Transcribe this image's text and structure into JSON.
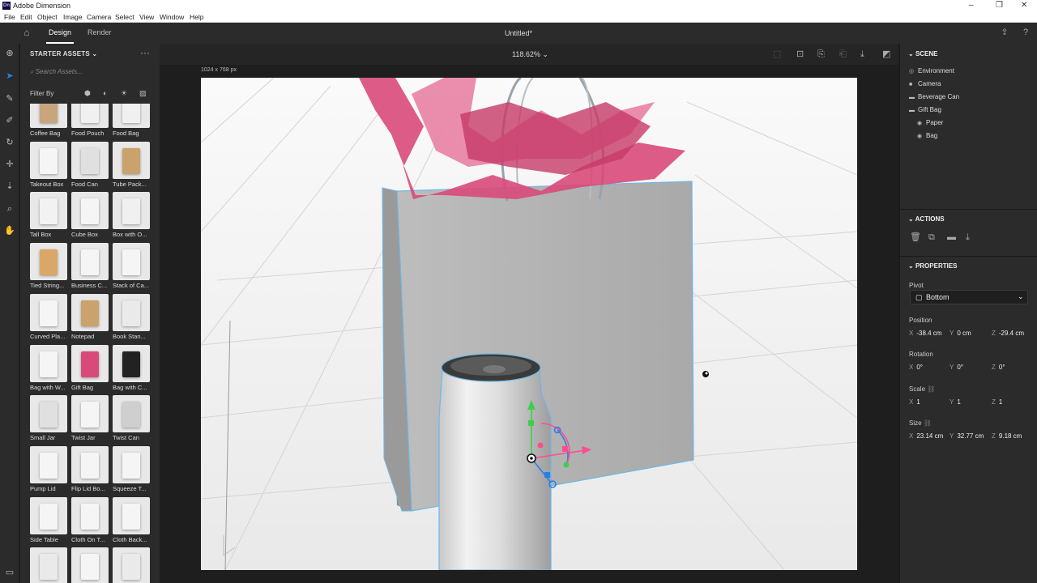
{
  "titlebar": {
    "title": "Adobe Dimension",
    "logo": "Dn"
  },
  "menu": [
    "File",
    "Edit",
    "Object",
    "Image",
    "Camera",
    "Select",
    "View",
    "Window",
    "Help"
  ],
  "topbar": {
    "tabs": [
      "Design",
      "Render"
    ],
    "doc_title": "Untitled*"
  },
  "viewport": {
    "zoom": "118.62%",
    "canvas_size": "1024 x 768 px"
  },
  "assets": {
    "header": "STARTER ASSETS",
    "search_placeholder": "Search Assets...",
    "filter_label": "Filter By",
    "items": [
      "Coffee Bag",
      "Food Pouch",
      "Food Bag",
      "Takeout Box",
      "Food Can",
      "Tube Pack...",
      "Tall Box",
      "Cube Box",
      "Box with O...",
      "Tied String...",
      "Business C...",
      "Stack of Ca...",
      "Curved Pla...",
      "Notepad",
      "Book Stan...",
      "Bag with W...",
      "Gift Bag",
      "Bag with C...",
      "Small Jar",
      "Twist Jar",
      "Twist Can",
      "Pump Lid",
      "Flip Lid Bo...",
      "Squeeze T...",
      "Side Table",
      "Cloth On T...",
      "Cloth Back...",
      "",
      "",
      ""
    ]
  },
  "scene": {
    "header": "SCENE",
    "items": [
      "Environment",
      "Camera",
      "Beverage Can",
      "Gift Bag",
      "Paper",
      "Bag"
    ]
  },
  "actions": {
    "header": "ACTIONS"
  },
  "properties": {
    "header": "PROPERTIES",
    "pivot_label": "Pivot",
    "pivot_value": "Bottom",
    "position_label": "Position",
    "position": {
      "x": "-38.4 cm",
      "y": "0 cm",
      "z": "-29.4 cm"
    },
    "rotation_label": "Rotation",
    "rotation": {
      "x": "0°",
      "y": "0°",
      "z": "0°"
    },
    "scale_label": "Scale",
    "scale": {
      "x": "1",
      "y": "1",
      "z": "1"
    },
    "size_label": "Size",
    "size": {
      "x": "23.14 cm",
      "y": "32.77 cm",
      "z": "9.18 cm"
    }
  },
  "colors": {
    "accent": "#2680eb",
    "panel": "#2b2b2b",
    "tissue": "#d84a7a"
  }
}
